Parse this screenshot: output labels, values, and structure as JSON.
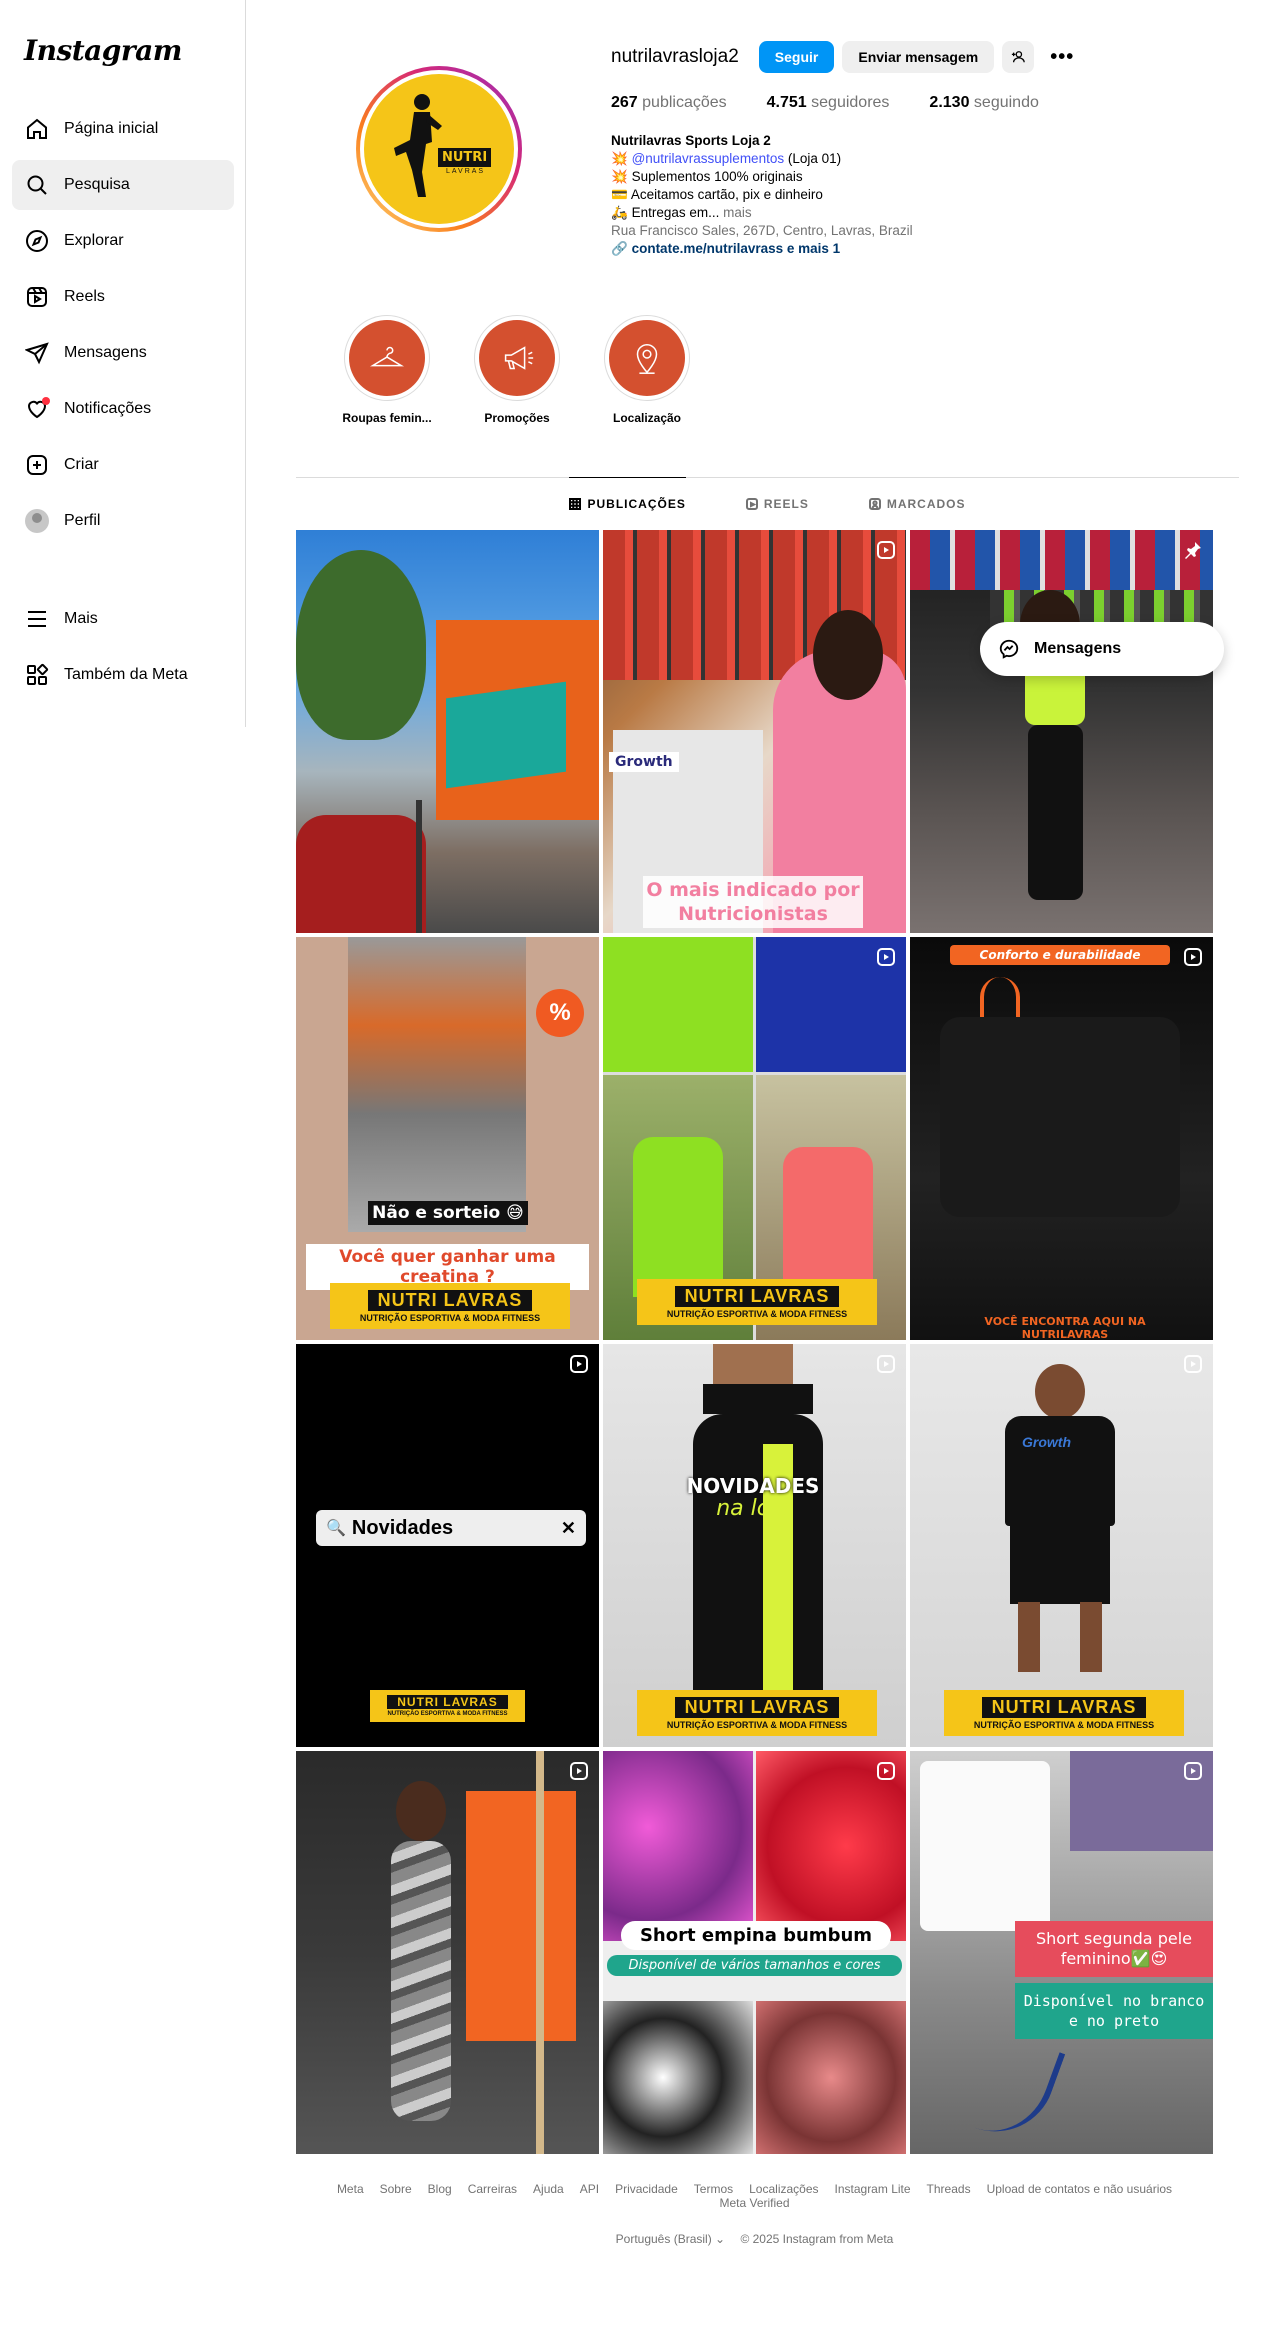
{
  "app": {
    "logo": "Instagram"
  },
  "sidebar": {
    "items": [
      {
        "label": "Página inicial",
        "icon": "home-icon"
      },
      {
        "label": "Pesquisa",
        "icon": "search-icon"
      },
      {
        "label": "Explorar",
        "icon": "compass-icon"
      },
      {
        "label": "Reels",
        "icon": "reels-icon"
      },
      {
        "label": "Mensagens",
        "icon": "send-icon"
      },
      {
        "label": "Notificações",
        "icon": "heart-icon"
      },
      {
        "label": "Criar",
        "icon": "plus-square-icon"
      },
      {
        "label": "Perfil",
        "icon": "avatar"
      }
    ],
    "bottom": [
      {
        "label": "Mais",
        "icon": "menu-icon"
      },
      {
        "label": "Também da Meta",
        "icon": "meta-grid-icon"
      }
    ]
  },
  "profile": {
    "username": "nutrilavrasloja2",
    "follow_label": "Seguir",
    "message_label": "Enviar mensagem",
    "stats": {
      "posts_n": "267",
      "posts_l": " publicações",
      "followers_n": "4.751",
      "followers_l": " seguidores",
      "following_n": "2.130",
      "following_l": " seguindo"
    },
    "bio": {
      "name": "Nutrilavras Sports Loja 2",
      "line1_mention": "@nutrilavrassuplementos",
      "line1_rest": " (Loja 01)",
      "line2": "Suplementos 100% originais",
      "line3": "Aceitamos cartão, pix e dinheiro",
      "line4": "Entregas em...",
      "line4_more": " mais",
      "address": "Rua Francisco Sales, 267D, Centro, Lavras, Brazil",
      "link": "contate.me/nutrilavrass e mais 1"
    },
    "logo_text": "NUTRI",
    "logo_sub": "LAVRAS"
  },
  "highlights": [
    {
      "label": "Roupas femin...",
      "icon": "hanger-icon"
    },
    {
      "label": "Promoções",
      "icon": "megaphone-icon"
    },
    {
      "label": "Localização",
      "icon": "location-pin-icon"
    }
  ],
  "tabs": [
    {
      "label": "PUBLICAÇÕES",
      "active": true
    },
    {
      "label": "REELS",
      "active": false
    },
    {
      "label": "MARCADOS",
      "active": false
    }
  ],
  "posts": {
    "p2_tag": "Growth",
    "p2_caption": "O mais indicado por Nutricionistas",
    "p4_text1": "Não e sorteio 😅",
    "p4_text2": "Você quer ganhar uma creatina ?",
    "p6_top": "Conforto e durabilidade",
    "p6_bottom": "VOCÊ ENCONTRA AQUI NA NUTRILAVRAS",
    "p7_search": "Novidades",
    "p8_t1": "NOVIDADES",
    "p8_t2": "na loja",
    "p11_t1": "Short empina bumbum",
    "p11_t2": "Disponível de vários tamanhos e cores",
    "p12_t1": "Short segunda pele feminino✅😍",
    "p12_t2": "Disponível no branco e no preto",
    "brand_title": "NUTRI  LAVRAS",
    "brand_sub": "NUTRIÇÃO ESPORTIVA & MODA FITNESS",
    "p9_shirt": "Growth"
  },
  "messages_pill": "Mensagens",
  "footer": {
    "links": [
      "Meta",
      "Sobre",
      "Blog",
      "Carreiras",
      "Ajuda",
      "API",
      "Privacidade",
      "Termos",
      "Localizações",
      "Instagram Lite",
      "Threads",
      "Upload de contatos e não usuários",
      "Meta Verified"
    ],
    "language": "Português (Brasil) ⌄",
    "copyright": "© 2025 Instagram from Meta"
  },
  "colors": {
    "accent": "#0095f6",
    "highlight": "#d4502f",
    "brand_yellow": "#f5c518"
  }
}
